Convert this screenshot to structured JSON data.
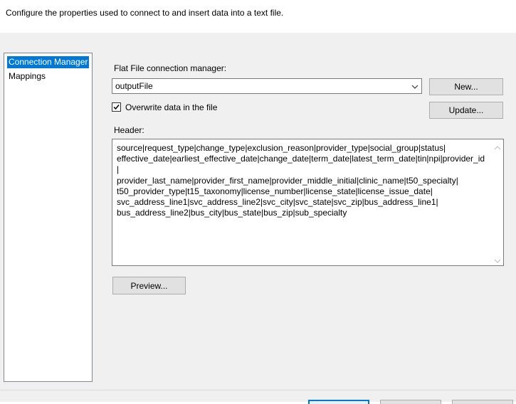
{
  "description": "Configure the properties used to connect to and insert data into a text file.",
  "nav": {
    "items": [
      {
        "label": "Connection Manager",
        "selected": true
      },
      {
        "label": "Mappings",
        "selected": false
      }
    ]
  },
  "connection": {
    "manager_label": "Flat File connection manager:",
    "manager_value": "outputFile",
    "new_button": "New...",
    "update_button": "Update...",
    "overwrite_label": "Overwrite data in the file",
    "overwrite_checked": true
  },
  "header": {
    "label": "Header:",
    "text": "source|request_type|change_type|exclusion_reason|provider_type|social_group|status|\neffective_date|earliest_effective_date|change_date|term_date|latest_term_date|tin|npi|provider_id|\nprovider_last_name|provider_first_name|provider_middle_initial|clinic_name|t50_specialty|\nt50_provider_type|t15_taxonomy|license_number|license_state|license_issue_date|\nsvc_address_line1|svc_address_line2|svc_city|svc_state|svc_zip|bus_address_line1|\nbus_address_line2|bus_city|bus_state|bus_zip|sub_specialty"
  },
  "preview_button": "Preview...",
  "colors": {
    "accent": "#0078d7",
    "dialog_bg": "#f0f0f0"
  },
  "icons": {
    "combo": "chevron-down-icon",
    "checkbox": "checkmark-icon",
    "scroll_up": "chevron-up-icon",
    "scroll_down": "chevron-down-icon"
  }
}
